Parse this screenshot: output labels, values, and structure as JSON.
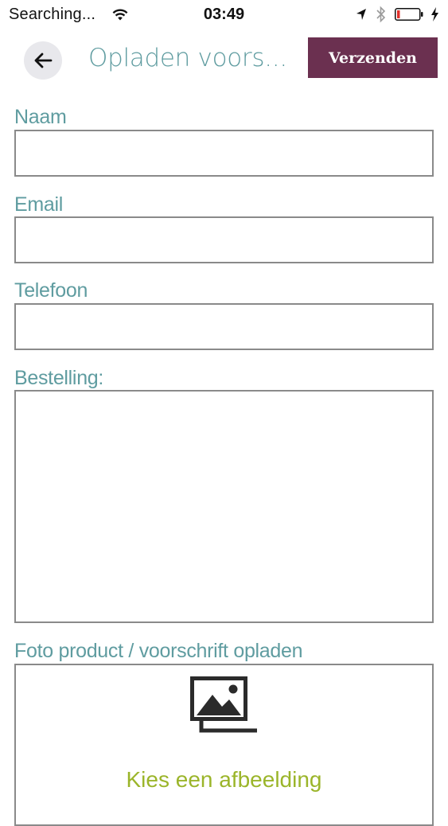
{
  "status_bar": {
    "carrier": "Searching...",
    "time": "03:49"
  },
  "nav": {
    "title": "Opladen voors...",
    "send_label": "Verzenden"
  },
  "form": {
    "fields": [
      {
        "label": "Naam",
        "value": ""
      },
      {
        "label": "Email",
        "value": ""
      },
      {
        "label": "Telefoon",
        "value": ""
      }
    ],
    "order": {
      "label": "Bestelling:",
      "value": ""
    },
    "upload": {
      "label": "Foto product / voorschrift opladen",
      "button_text": "Kies een afbeelding"
    }
  },
  "colors": {
    "label_teal": "#5f9ca0",
    "send_bg": "#6b3050",
    "upload_green": "#9bb52a",
    "border_gray": "#8a8a8a",
    "back_bg": "#e8e8ec"
  },
  "icons": {
    "back": "arrow-left-icon",
    "wifi": "wifi-icon",
    "location": "location-arrow-icon",
    "bluetooth": "bluetooth-icon",
    "battery": "battery-low-icon",
    "charge": "charging-bolt-icon",
    "upload": "image-gallery-icon"
  }
}
